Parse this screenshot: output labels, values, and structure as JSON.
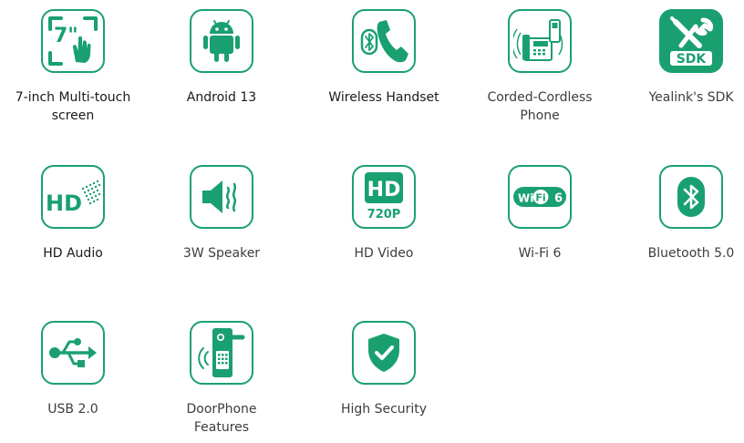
{
  "brand": {
    "accent": "#1aa070",
    "accent_dark": "#0f7f57",
    "tile_fill": "#1aa070"
  },
  "features": [
    {
      "label": "7-inch Multi-touch\nscreen",
      "badge": "7\"",
      "icon": "touchscreen-icon"
    },
    {
      "label": "Android 13",
      "icon": "android-icon"
    },
    {
      "label": "Wireless Handset",
      "icon": "wireless-handset-icon"
    },
    {
      "label": "Corded-Cordless\nPhone",
      "icon": "desk-phone-icon"
    },
    {
      "label": "Yealink's SDK",
      "badge": "SDK",
      "icon": "sdk-tools-icon"
    },
    {
      "label": "HD Audio",
      "badge": "HD",
      "icon": "hd-audio-icon"
    },
    {
      "label": "3W Speaker",
      "icon": "speaker-icon"
    },
    {
      "label": "HD Video",
      "badge": "HD",
      "sub_badge": "720P",
      "icon": "hd-video-icon"
    },
    {
      "label": "Wi-Fi 6",
      "badge_wi": "Wi",
      "badge_fi": "Fi",
      "badge_num": "6",
      "icon": "wifi6-icon"
    },
    {
      "label": "Bluetooth 5.0",
      "icon": "bluetooth-icon"
    },
    {
      "label": "USB 2.0",
      "icon": "usb-icon"
    },
    {
      "label": "DoorPhone\nFeatures",
      "icon": "doorphone-icon"
    },
    {
      "label": "High Security",
      "icon": "shield-check-icon"
    }
  ]
}
